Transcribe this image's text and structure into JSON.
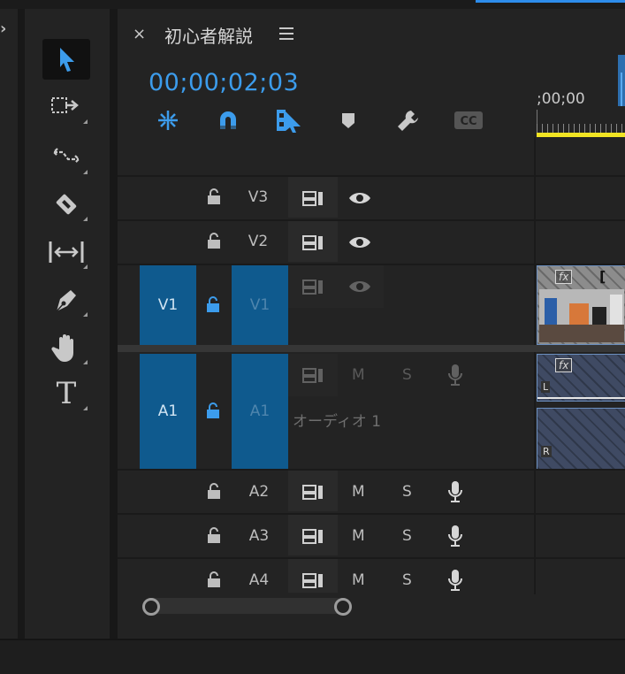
{
  "sequence": {
    "title": "初心者解説",
    "timecode": "00;00;02;03",
    "ruler_time": ";00;00"
  },
  "toolbar": {
    "tools": [
      "selection-tool",
      "track-select-forward-tool",
      "ripple-edit-tool",
      "razor-tool",
      "slip-tool",
      "pen-tool",
      "hand-tool",
      "type-tool"
    ],
    "type_tool_label": "T"
  },
  "timeline_buttons": [
    "snap-in-timeline",
    "linked-selection",
    "add-marker-nest",
    "add-marker",
    "timeline-settings",
    "captions"
  ],
  "tracks": {
    "v3": {
      "label": "V3"
    },
    "v2": {
      "label": "V2"
    },
    "v1": {
      "label": "V1",
      "source": "V1"
    },
    "a1": {
      "label": "A1",
      "source": "A1",
      "name": "オーディオ 1",
      "mute": "M",
      "solo": "S"
    },
    "a2": {
      "label": "A2",
      "mute": "M",
      "solo": "S"
    },
    "a3": {
      "label": "A3",
      "mute": "M",
      "solo": "S"
    },
    "a4": {
      "label": "A4",
      "mute": "M",
      "solo": "S"
    }
  },
  "clips": {
    "fx_label": "fx",
    "a1_left_channel": "L",
    "a1_right_channel": "R"
  },
  "colors": {
    "accent": "#3c9cec",
    "patch": "#0f5a8e",
    "work_area": "#f1e423"
  }
}
